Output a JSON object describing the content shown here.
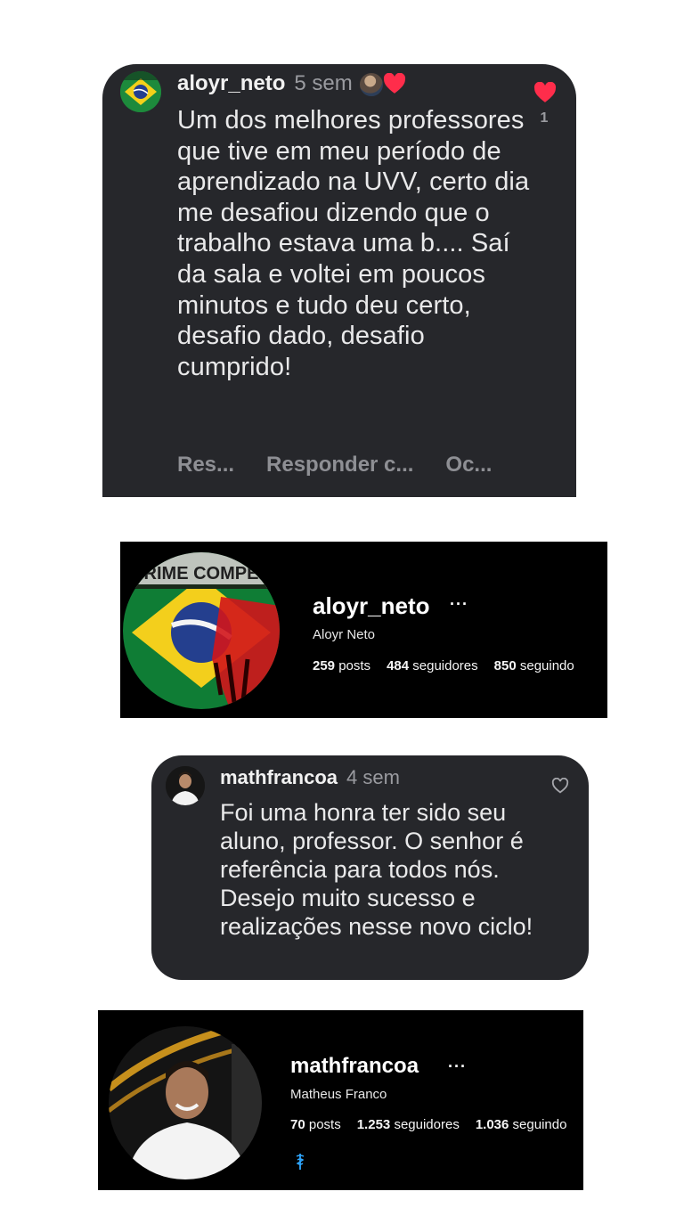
{
  "comment_1": {
    "username": "aloyr_neto",
    "time": "5 sem",
    "body": "Um dos melhores professores que tive em meu período de aprendizado na UVV, certo dia me desafiou dizendo que o trabalho estava uma b.... Saí da sala e voltei em poucos minutos e tudo deu certo, desafio dado, desafio cumprido!",
    "like_count": "1",
    "actions": [
      "Res...",
      "Responder c...",
      "Oc..."
    ]
  },
  "profile_1": {
    "username": "aloyr_neto",
    "more": "···",
    "display_name": "Aloyr Neto",
    "avatar_caption": "CRIME COMPER",
    "stats": [
      {
        "value": "259",
        "label": "posts"
      },
      {
        "value": "484",
        "label": "seguidores"
      },
      {
        "value": "850",
        "label": "seguindo"
      }
    ]
  },
  "comment_2": {
    "username": "mathfrancoa",
    "time": "4 sem",
    "body": "Foi uma honra ter sido seu aluno, professor. O senhor é referência para todos nós. Desejo muito sucesso e realizações nesse novo ciclo!"
  },
  "profile_2": {
    "username": "mathfrancoa",
    "more": "···",
    "display_name": "Matheus Franco",
    "stats": [
      {
        "value": "70",
        "label": "posts"
      },
      {
        "value": "1.253",
        "label": "seguidores"
      },
      {
        "value": "1.036",
        "label": "seguindo"
      }
    ],
    "bio_icon": "caduceus-icon"
  },
  "colors": {
    "card_background": "#26272b",
    "profile_background": "#000000",
    "like_red": "#ff2d4b",
    "muted_text": "#9a9ba0",
    "bio_icon_blue": "#2fa7ff"
  },
  "icons": [
    "heart-filled-icon",
    "heart-outline-icon",
    "more-icon",
    "caduceus-icon"
  ]
}
